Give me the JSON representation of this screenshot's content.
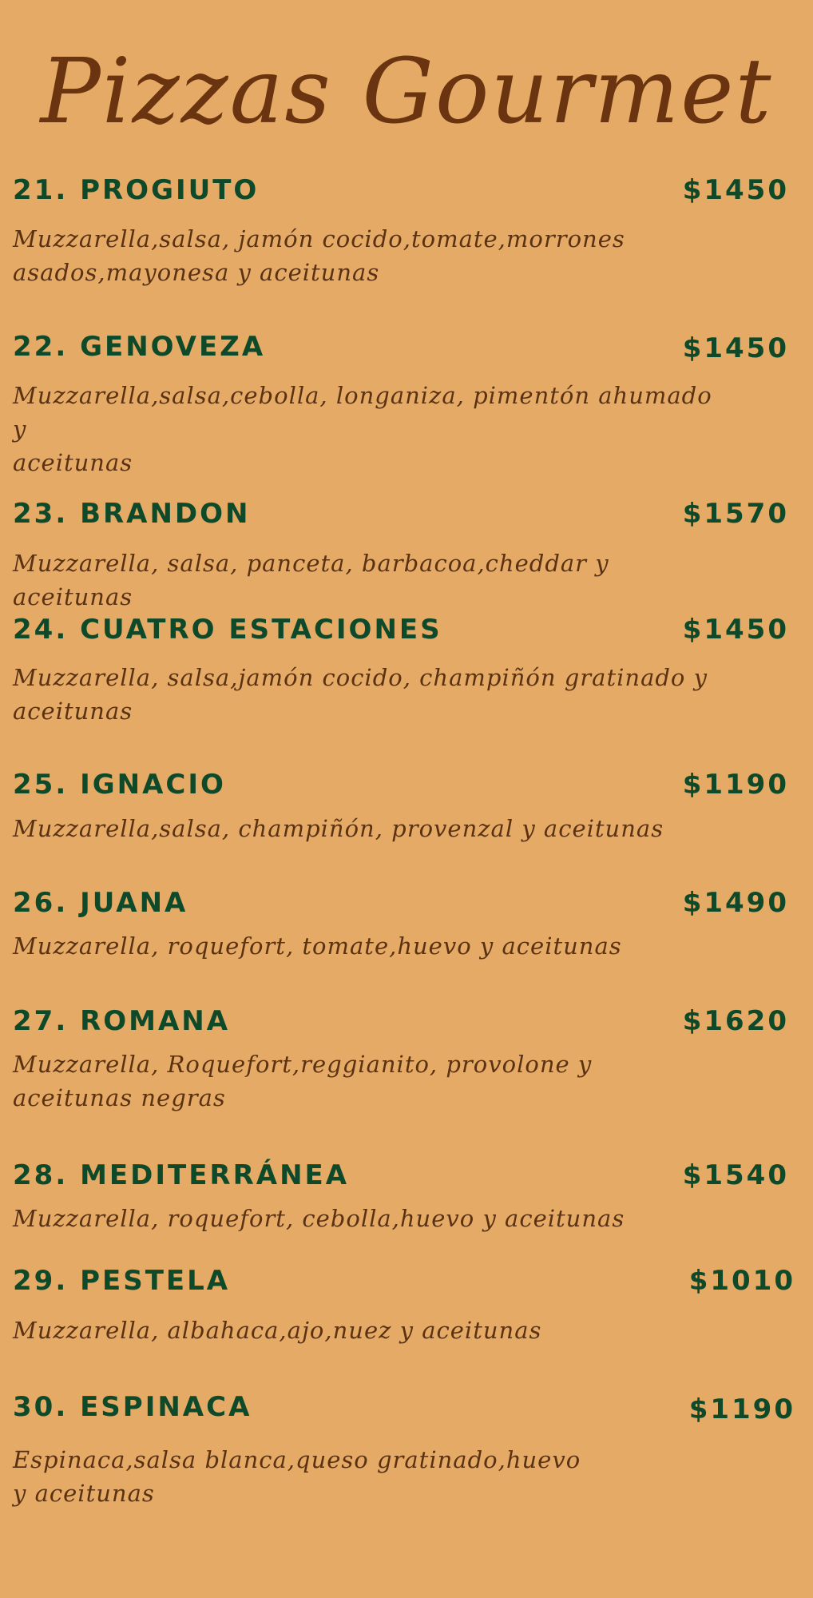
{
  "title": "Pizzas Gourmet",
  "menu": {
    "items": [
      {
        "name": "21. PROGIUTO",
        "price": "$1450",
        "description": "Muzzarella,salsa, jamón cocido,tomate,morrones\nasados,mayonesa y aceitunas"
      },
      {
        "name": "22. GENOVEZA",
        "price": "$1450",
        "description": "Muzzarella,salsa,cebolla, longaniza, pimentón ahumado y\naceitunas"
      },
      {
        "name": "23. BRANDON",
        "price": "$1570",
        "description": "Muzzarella, salsa, panceta, barbacoa,cheddar y aceitunas"
      },
      {
        "name": "24. CUATRO ESTACIONES",
        "price": "$1450",
        "description": "Muzzarella, salsa,jamón cocido, champiñón gratinado y\naceitunas"
      },
      {
        "name": "25. IGNACIO",
        "price": "$1190",
        "description": "Muzzarella,salsa, champiñón, provenzal y aceitunas"
      },
      {
        "name": "26. JUANA",
        "price": "$1490",
        "description": "Muzzarella, roquefort, tomate,huevo y aceitunas"
      },
      {
        "name": "27. ROMANA",
        "price": "$1620",
        "description": "Muzzarella, Roquefort,reggianito, provolone y\n aceitunas negras"
      },
      {
        "name": "28. MEDITERRÁNEA",
        "price": "$1540",
        "description": "Muzzarella, roquefort, cebolla,huevo y aceitunas"
      },
      {
        "name": "29. PESTELA",
        "price": "$1010",
        "description": " Muzzarella, albahaca,ajo,nuez y aceitunas"
      },
      {
        "name": "30. ESPINACA",
        "price": "$1190",
        "description": "Espinaca,salsa blanca,queso gratinado,huevo\n y aceitunas"
      }
    ]
  },
  "colors": {
    "background": "#E5AA66",
    "title": "#6A3410",
    "item_name": "#0E4A2A",
    "description": "#5A3212"
  }
}
